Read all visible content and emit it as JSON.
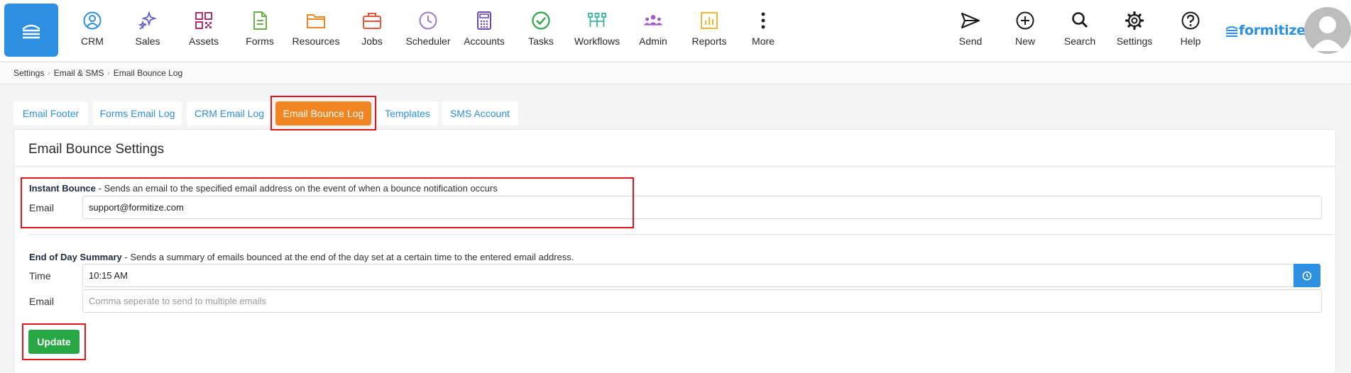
{
  "nav": {
    "items": [
      {
        "label": "CRM",
        "icon": "crm-icon",
        "color": "#2d8fe0"
      },
      {
        "label": "Sales",
        "icon": "sales-sparkle-icon",
        "color": "#5b5fc7"
      },
      {
        "label": "Assets",
        "icon": "assets-qr-icon",
        "color": "#b0306a"
      },
      {
        "label": "Forms",
        "icon": "forms-document-icon",
        "color": "#6ab04c"
      },
      {
        "label": "Resources",
        "icon": "resources-folder-icon",
        "color": "#f08521"
      },
      {
        "label": "Jobs",
        "icon": "jobs-briefcase-icon",
        "color": "#e8553d"
      },
      {
        "label": "Scheduler",
        "icon": "scheduler-clock-icon",
        "color": "#9b7cc9"
      },
      {
        "label": "Accounts",
        "icon": "accounts-calculator-icon",
        "color": "#6c4ab6"
      },
      {
        "label": "Tasks",
        "icon": "tasks-check-icon",
        "color": "#2ea44f"
      },
      {
        "label": "Workflows",
        "icon": "workflows-icon",
        "color": "#3bb39a"
      },
      {
        "label": "Admin",
        "icon": "admin-users-icon",
        "color": "#a05bc5"
      },
      {
        "label": "Reports",
        "icon": "reports-chart-icon",
        "color": "#f2b632"
      },
      {
        "label": "More",
        "icon": "more-dots-icon",
        "color": "#222222"
      }
    ],
    "right_items": [
      {
        "label": "Send",
        "icon": "send-icon"
      },
      {
        "label": "New",
        "icon": "new-plus-icon"
      },
      {
        "label": "Search",
        "icon": "search-icon"
      },
      {
        "label": "Settings",
        "icon": "settings-gear-icon"
      },
      {
        "label": "Help",
        "icon": "help-icon"
      }
    ],
    "brand": "formitize"
  },
  "breadcrumb": [
    "Settings",
    "Email & SMS",
    "Email Bounce Log"
  ],
  "tabs": [
    {
      "label": "Email Footer",
      "active": false
    },
    {
      "label": "Forms Email Log",
      "active": false
    },
    {
      "label": "CRM Email Log",
      "active": false
    },
    {
      "label": "Email Bounce Log",
      "active": true
    },
    {
      "label": "Templates",
      "active": false
    },
    {
      "label": "SMS Account",
      "active": false
    }
  ],
  "panel": {
    "title": "Email Bounce Settings",
    "instant": {
      "heading": "Instant Bounce",
      "description": " - Sends an email to the specified email address on the event of when a bounce notification occurs",
      "email_label": "Email",
      "email_value": "support@formitize.com"
    },
    "summary": {
      "heading": "End of Day Summary",
      "description": " - Sends a summary of emails bounced at the end of the day set at a certain time to the entered email address.",
      "time_label": "Time",
      "time_value": "10:15 AM",
      "email_label": "Email",
      "email_placeholder": "Comma seperate to send to multiple emails"
    },
    "update_label": "Update"
  },
  "colors": {
    "primary": "#2d8fe0",
    "active_tab": "#f08521",
    "update": "#28a745",
    "highlight": "#e1161b"
  }
}
